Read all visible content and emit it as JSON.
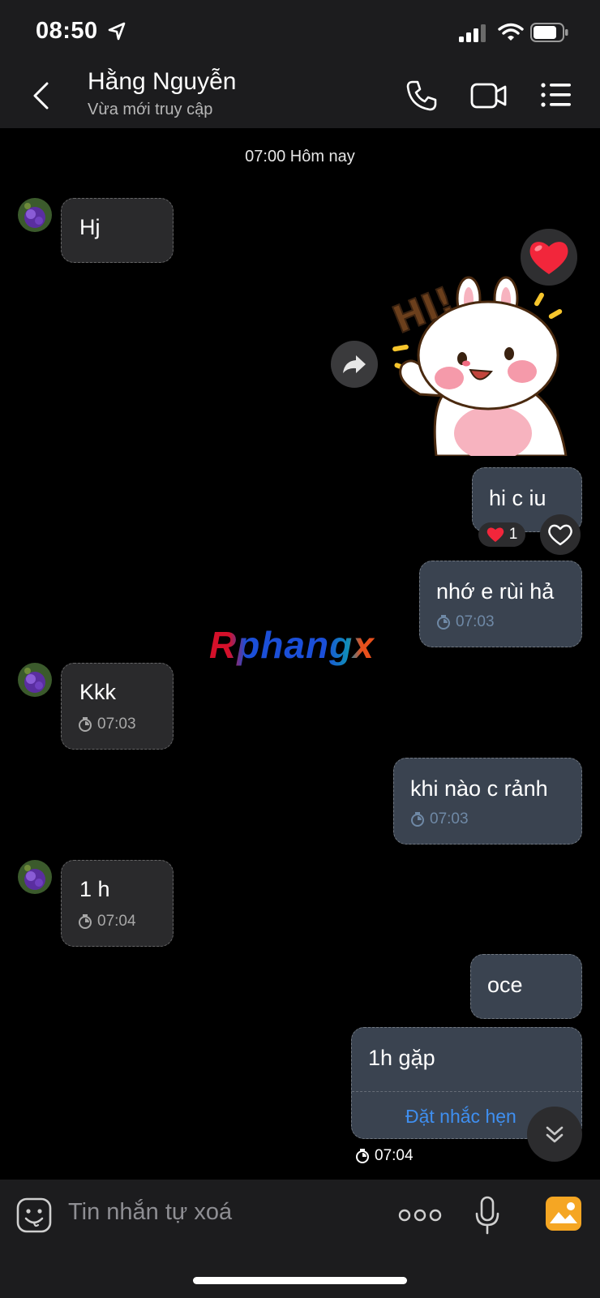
{
  "status_bar": {
    "time": "08:50"
  },
  "header": {
    "contact_name": "Hằng Nguyễn",
    "status": "Vừa mới truy cập"
  },
  "chat": {
    "date_label": "07:00 Hôm nay",
    "messages": [
      {
        "from": "contact",
        "text": "Hj"
      },
      {
        "from": "me",
        "type": "sticker",
        "sticker_text": "HI!",
        "reaction": "heart"
      },
      {
        "from": "me",
        "text": "hi c iu",
        "reaction_count": "1"
      },
      {
        "from": "me",
        "text": "nhớ e rùi hả",
        "time": "07:03"
      },
      {
        "from": "contact",
        "text": "Kkk",
        "time": "07:03"
      },
      {
        "from": "me",
        "text": "khi nào c rảnh",
        "time": "07:03"
      },
      {
        "from": "contact",
        "text": "1 h",
        "time": "07:04"
      },
      {
        "from": "me",
        "text": "oce"
      },
      {
        "from": "me",
        "text": "1h gặp",
        "action": "Đặt nhắc hẹn",
        "time": "07:04"
      }
    ]
  },
  "watermark": "Rphangx",
  "input_bar": {
    "placeholder": "Tin nhắn tự xoá"
  },
  "colors": {
    "background": "#000000",
    "bar": "#1c1c1e",
    "incoming_bubble": "#2a2a2c",
    "outgoing_bubble": "#3a4350",
    "link": "#3f8ff0",
    "accent": "#f5a623"
  }
}
